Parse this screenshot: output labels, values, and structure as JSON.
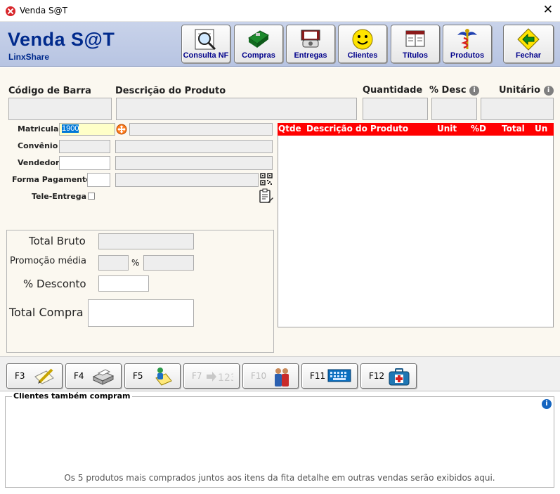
{
  "window": {
    "title": "Venda S@T",
    "close_glyph": "✕"
  },
  "brand": {
    "title": "Venda S@T",
    "subtitle": "LinxShare"
  },
  "toolbar": {
    "consulta_nf": "Consulta NF",
    "compras": "Compras",
    "entregas": "Entregas",
    "clientes": "Clientes",
    "titulos": "Títulos",
    "produtos": "Produtos",
    "fechar": "Fechar"
  },
  "product_entry": {
    "codigo_label": "Código de Barra",
    "descricao_label": "Descrição do Produto",
    "quantidade_label": "Quantidade",
    "desconto_label": "% Desc",
    "unitario_label": "Unitário"
  },
  "sale_info": {
    "matricula_label": "Matricula",
    "matricula_value": "1900",
    "convenio_label": "Convênio",
    "vendedor_label": "Vendedor",
    "forma_pagamento_label": "Forma Pagamento",
    "tele_entrega_label": "Tele-Entrega"
  },
  "grid": {
    "columns": [
      "Qtde",
      "Descrição do Produto",
      "Unit",
      "%D",
      "Total",
      "Un"
    ]
  },
  "totals": {
    "total_bruto_label": "Total Bruto",
    "promocao_label": "Promoção média",
    "percent_symbol": "%",
    "desconto_label": "% Desconto",
    "total_compra_label": "Total Compra"
  },
  "fkeys": {
    "f3": "F3",
    "f4": "F4",
    "f5": "F5",
    "f7": "F7",
    "f10": "F10",
    "f11": "F11",
    "f12": "F12"
  },
  "bottom": {
    "legend": "Clientes também compram",
    "note": "Os 5 produtos mais comprados juntos aos itens da fita detalhe em outras vendas serão exibidos aqui."
  },
  "colors": {
    "brand": "#002a8c",
    "grid_header": "#ff0000",
    "header_bg": "#c9d3ea"
  }
}
